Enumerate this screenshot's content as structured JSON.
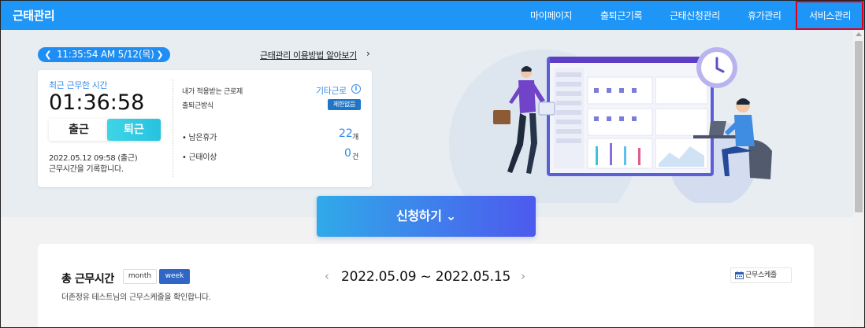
{
  "nav": {
    "brand": "근태관리",
    "items": [
      {
        "label": "마이페이지"
      },
      {
        "label": "출퇴근기록"
      },
      {
        "label": "근태신청관리"
      },
      {
        "label": "휴가관리"
      },
      {
        "label": "서비스관리"
      }
    ],
    "highlight_color": "#e0001b",
    "bg_color": "#1e96f7"
  },
  "clock": {
    "prev_icon": "chevron-left-icon",
    "datetime": "11:35:54 AM 5/12(목)",
    "next_icon": "chevron-right-icon"
  },
  "guide": {
    "link": "근태관리 이용방법 알아보기",
    "arrow": "›"
  },
  "status_card": {
    "recent_label": "최근 근무한 시간",
    "recent_time": "01:36:58",
    "clock_in_label": "출근",
    "clock_out_label": "퇴근",
    "log_line1": "2022.05.12 09:58 (출근)",
    "log_line2": "근무시간을 기록합니다.",
    "applied_system_label": "내가 적용받는 근로제",
    "commute_method_label": "출퇴근방식",
    "other_work_label": "기타근로",
    "info_icon": "info-icon",
    "restriction_badge": "제한없음",
    "leave_label": "• 남은휴가",
    "leave_value": "22",
    "leave_unit": "개",
    "anomaly_label": "• 근태이상",
    "anomaly_value": "0",
    "anomaly_unit": "건"
  },
  "apply_button": {
    "label": "신청하기 ⌄"
  },
  "work_summary": {
    "title": "총 근무시간",
    "tab_month": "month",
    "tab_week": "week",
    "active_tab": "week",
    "subtitle": "더존정유 테스트님의 근무스케줄을 확인합니다.",
    "prev": "‹",
    "range": "2022.05.09 ~ 2022.05.15",
    "next": "›",
    "schedule_button": "근무스케줄",
    "schedule_icon": "calendar-icon"
  }
}
